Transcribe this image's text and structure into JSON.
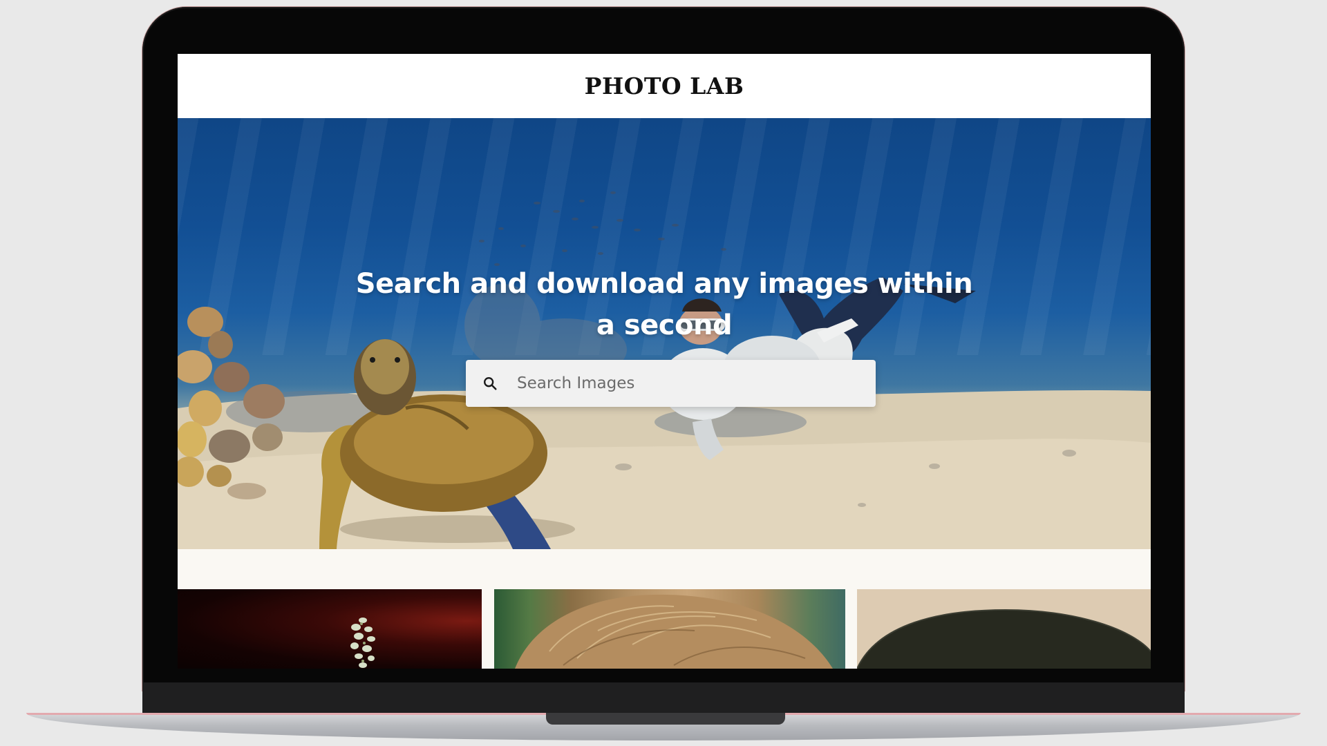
{
  "site": {
    "brand": "PHOTO LAB"
  },
  "hero": {
    "title": "Search and download any images within a second"
  },
  "search": {
    "icon": "search-icon",
    "placeholder": "Search Images",
    "value": ""
  },
  "gallery": {
    "items": [
      {
        "subject": "coral plant on dark red background"
      },
      {
        "subject": "close-up of blond hair"
      },
      {
        "subject": "dark dome on beige background"
      }
    ]
  },
  "colors": {
    "header_bg": "#ffffff",
    "search_bg": "#f1f1f1",
    "hero_water": "#124f94"
  }
}
